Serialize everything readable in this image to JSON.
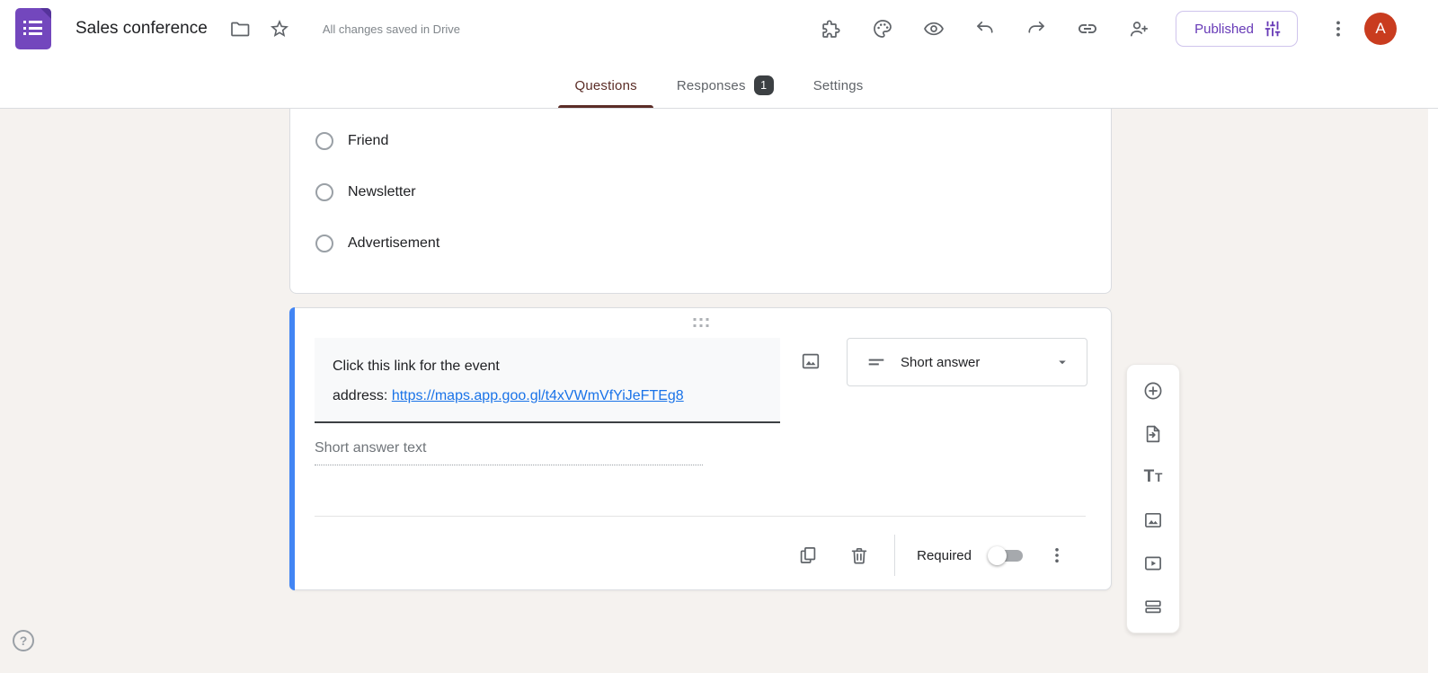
{
  "header": {
    "title": "Sales conference",
    "saved_status": "All changes saved in Drive",
    "published_label": "Published",
    "avatar_letter": "A",
    "toolbar_icons": [
      "extensions-icon",
      "palette-icon",
      "preview-eye-icon",
      "undo-icon",
      "redo-icon",
      "copy-link-icon",
      "person-add-icon",
      "tune-icon",
      "kebab-menu-icon"
    ]
  },
  "tabs": {
    "questions": "Questions",
    "responses": "Responses",
    "responses_badge": "1",
    "settings": "Settings"
  },
  "previous_card": {
    "options": [
      "Friend",
      "Newsletter",
      "Advertisement"
    ]
  },
  "selected_card": {
    "title_line1": "Click this link for the event",
    "title_line2_prefix": "address: ",
    "title_link": "https://maps.app.goo.gl/t4xVWmVfYiJeFTEg8",
    "type_label": "Short answer",
    "answer_placeholder": "Short answer text",
    "required_label": "Required",
    "required_on": false,
    "footer_icons": [
      "duplicate-icon",
      "trash-icon",
      "kebab-menu-icon"
    ]
  },
  "side_toolbar": {
    "icons": [
      "add-question-icon",
      "import-questions-icon",
      "add-title-icon",
      "add-image-icon",
      "add-video-icon",
      "add-section-icon"
    ],
    "tt_large": "T",
    "tt_small": "T"
  },
  "help": {
    "label": "?"
  },
  "colors": {
    "accent_tab": "#5b2d27",
    "selected_border": "#4285f4",
    "link": "#1a73e8",
    "published_text": "#673ab7",
    "avatar_bg": "#c93c1f",
    "logo_purple": "#7347bd",
    "page_bg": "#f5f2ef"
  }
}
